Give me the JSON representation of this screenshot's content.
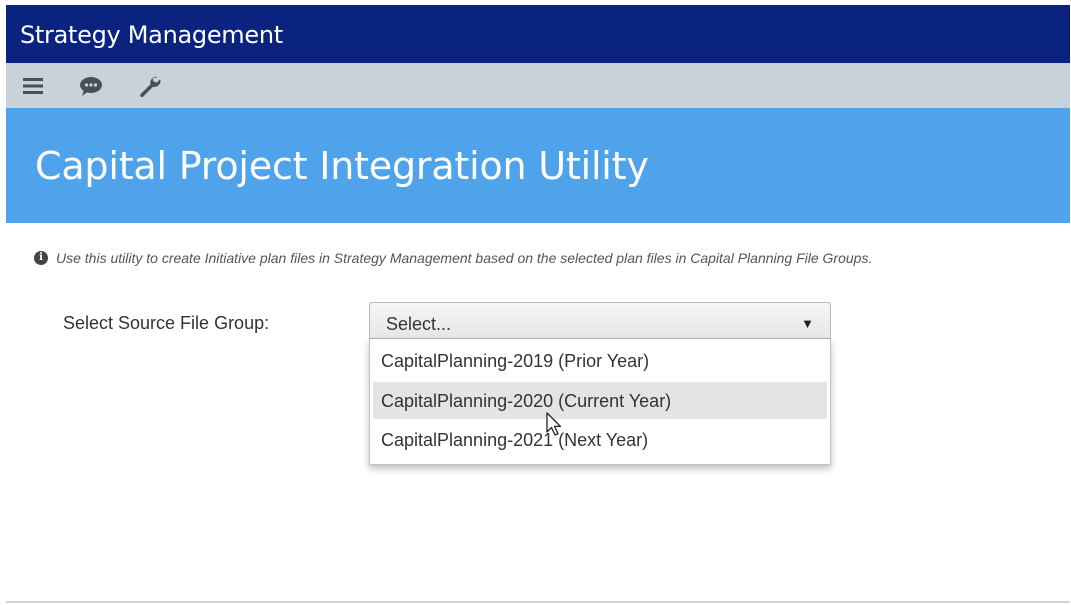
{
  "app": {
    "title": "Strategy Management"
  },
  "toolbar": {
    "icons": [
      "menu-icon",
      "chat-icon",
      "wrench-icon"
    ]
  },
  "banner": {
    "title": "Capital Project Integration Utility",
    "color": "#4fa3ea"
  },
  "header_color": "#0a237e",
  "info": {
    "text": "Use this utility to create Initiative plan files in Strategy Management based on the selected plan files in Capital Planning File Groups."
  },
  "form": {
    "source_label": "Select Source File Group:",
    "select_value": "Select...",
    "options": [
      "CapitalPlanning-2019 (Prior Year)",
      "CapitalPlanning-2020 (Current Year)",
      "CapitalPlanning-2021 (Next Year)"
    ],
    "highlighted_option": "CapitalPlanning-2020 (Current Year)"
  }
}
